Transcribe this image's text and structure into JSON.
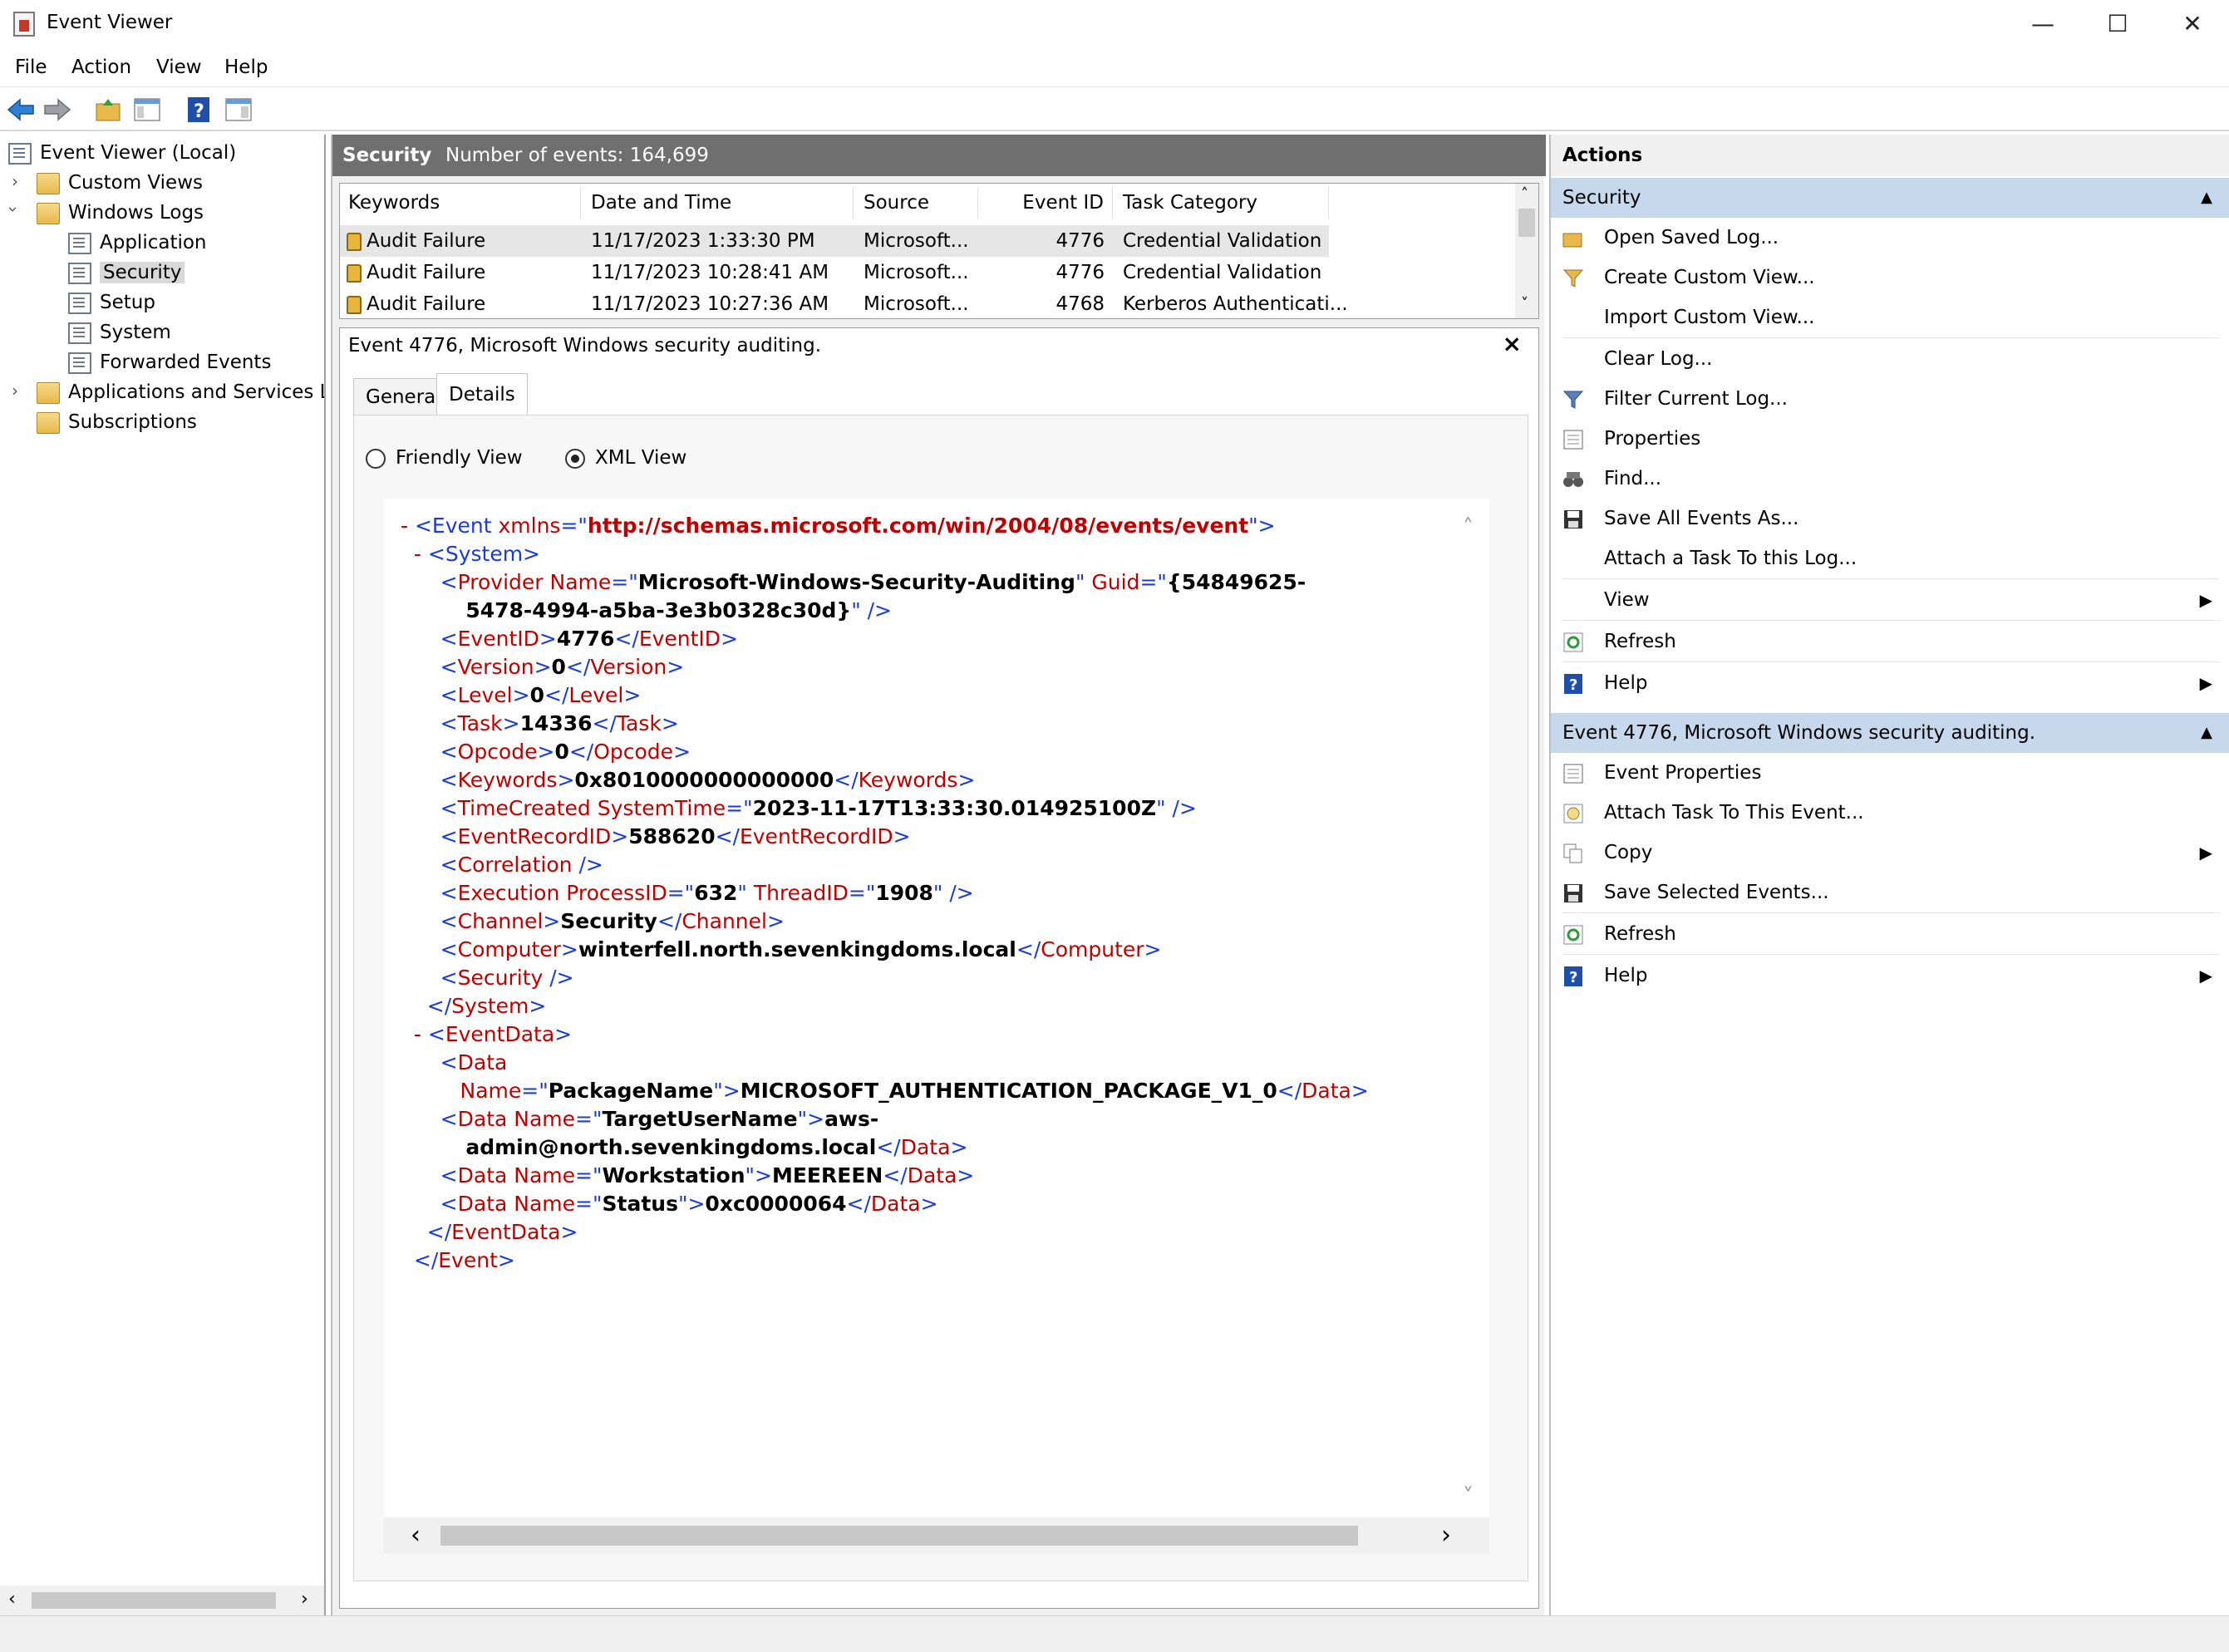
{
  "window": {
    "title": "Event Viewer",
    "minimize": "—",
    "maximize": "☐",
    "close": "✕"
  },
  "menu": [
    "File",
    "Action",
    "View",
    "Help"
  ],
  "tree": {
    "root": "Event Viewer (Local)",
    "custom_views": "Custom Views",
    "windows_logs": "Windows Logs",
    "application": "Application",
    "security": "Security",
    "setup": "Setup",
    "system": "System",
    "forwarded": "Forwarded Events",
    "apps_services": "Applications and Services Lo",
    "subscriptions": "Subscriptions"
  },
  "center": {
    "log_name": "Security",
    "event_count": "Number of events: 164,699",
    "columns": [
      "Keywords",
      "Date and Time",
      "Source",
      "Event ID",
      "Task Category"
    ],
    "rows": [
      [
        "Audit Failure",
        "11/17/2023 1:33:30 PM",
        "Microsoft...",
        "4776",
        "Credential Validation"
      ],
      [
        "Audit Failure",
        "11/17/2023 10:28:41 AM",
        "Microsoft...",
        "4776",
        "Credential Validation"
      ],
      [
        "Audit Failure",
        "11/17/2023 10:27:36 AM",
        "Microsoft...",
        "4768",
        "Kerberos Authenticati..."
      ]
    ]
  },
  "detail": {
    "title": "Event 4776, Microsoft Windows security auditing.",
    "tab_general": "General",
    "tab_details": "Details",
    "friendly_view": "Friendly View",
    "xml_view": "XML View",
    "xml": {
      "event_ns": "http://schemas.microsoft.com/win/2004/08/events/event",
      "provider_name": "Microsoft-Windows-Security-Auditing",
      "guid_1": "{54849625-",
      "guid_2": "5478-4994-a5ba-3e3b0328c30d}",
      "event_id": "4776",
      "version": "0",
      "level": "0",
      "task": "14336",
      "opcode": "0",
      "keywords": "0x8010000000000000",
      "time_created": "2023-11-17T13:33:30.014925100Z",
      "record_id": "588620",
      "process_id": "632",
      "thread_id": "1908",
      "channel": "Security",
      "computer": "winterfell.north.sevenkingdoms.local",
      "data_package_name": "PackageName",
      "package_value": "MICROSOFT_AUTHENTICATION_PACKAGE_V1_0",
      "data_target_user": "TargetUserName",
      "target_user_1": "aws-",
      "target_user_2": "admin@north.sevenkingdoms.local",
      "data_workstation": "Workstation",
      "workstation_value": "MEEREEN",
      "data_status": "Status",
      "status_value": "0xc0000064"
    }
  },
  "actions": {
    "title": "Actions",
    "section1": "Security",
    "items1": [
      "Open Saved Log...",
      "Create Custom View...",
      "Import Custom View...",
      "Clear Log...",
      "Filter Current Log...",
      "Properties",
      "Find...",
      "Save All Events As...",
      "Attach a Task To this Log...",
      "View",
      "Refresh",
      "Help"
    ],
    "section2": "Event 4776, Microsoft Windows security auditing.",
    "items2": [
      "Event Properties",
      "Attach Task To This Event...",
      "Copy",
      "Save Selected Events...",
      "Refresh",
      "Help"
    ]
  },
  "colors": {
    "header_bg": "#6f6f6f",
    "section_bg": "#c5d8ec",
    "xml_tag": "#1a3bd6",
    "xml_attr": "#c00000"
  }
}
